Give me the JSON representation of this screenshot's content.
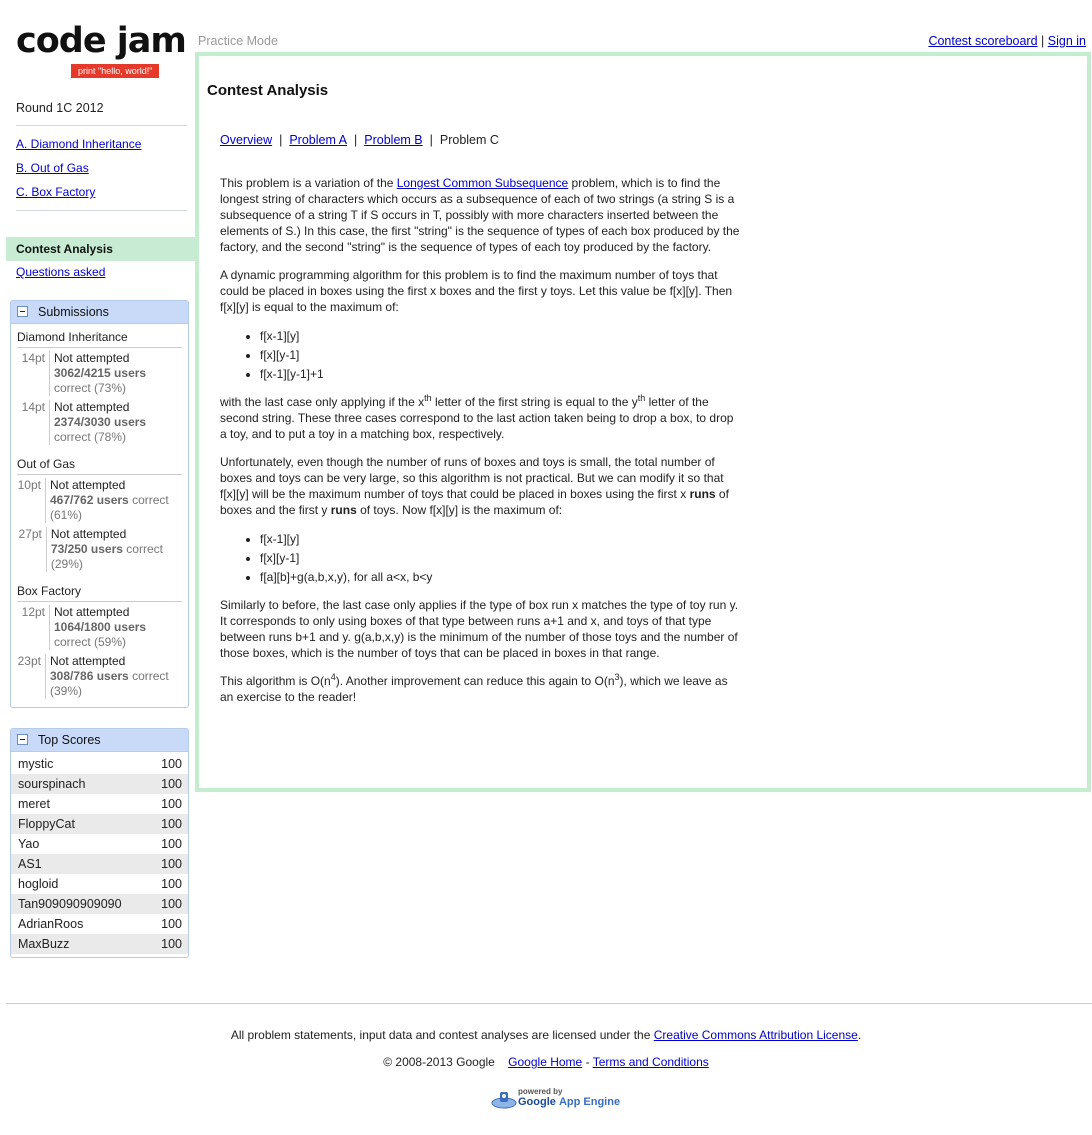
{
  "logo": {
    "text": "code jam",
    "tagline": "print \"hello, world!\""
  },
  "header": {
    "mode": "Practice Mode",
    "scoreboard_link": "Contest scoreboard",
    "separator": "|",
    "signin_link": "Sign in"
  },
  "sidebar": {
    "round": "Round 1C 2012",
    "problems": [
      "A. Diamond Inheritance",
      "B. Out of Gas",
      "C. Box Factory"
    ],
    "active_nav": "Contest Analysis",
    "questions_link": "Questions asked"
  },
  "submissions": {
    "title": "Submissions",
    "groups": [
      {
        "name": "Diamond Inheritance",
        "rows": [
          {
            "pts": "14pt",
            "status": "Not attempted",
            "users": "3062/4215 users",
            "correct": "correct (73%)"
          },
          {
            "pts": "14pt",
            "status": "Not attempted",
            "users": "2374/3030 users",
            "correct": "correct (78%)"
          }
        ]
      },
      {
        "name": "Out of Gas",
        "rows": [
          {
            "pts": "10pt",
            "status": "Not attempted",
            "users": "467/762 users",
            "correct": "correct (61%)"
          },
          {
            "pts": "27pt",
            "status": "Not attempted",
            "users": "73/250 users",
            "correct": "correct (29%)"
          }
        ]
      },
      {
        "name": "Box Factory",
        "rows": [
          {
            "pts": "12pt",
            "status": "Not attempted",
            "users": "1064/1800 users",
            "correct": "correct (59%)"
          },
          {
            "pts": "23pt",
            "status": "Not attempted",
            "users": "308/786 users",
            "correct": "correct (39%)"
          }
        ]
      }
    ]
  },
  "top_scores": {
    "title": "Top Scores",
    "rows": [
      {
        "name": "mystic",
        "score": "100"
      },
      {
        "name": "sourspinach",
        "score": "100"
      },
      {
        "name": "meret",
        "score": "100"
      },
      {
        "name": "FloppyCat",
        "score": "100"
      },
      {
        "name": "Yao",
        "score": "100"
      },
      {
        "name": "AS1",
        "score": "100"
      },
      {
        "name": "hogloid",
        "score": "100"
      },
      {
        "name": "Tan909090909090",
        "score": "100"
      },
      {
        "name": "AdrianRoos",
        "score": "100"
      },
      {
        "name": "MaxBuzz",
        "score": "100"
      }
    ]
  },
  "main": {
    "title": "Contest Analysis",
    "tabs": {
      "overview": "Overview",
      "a": "Problem A",
      "b": "Problem B",
      "c": "Problem C",
      "sep": "|"
    },
    "p1_a": "This problem is a variation of the ",
    "p1_link": "Longest Common Subsequence",
    "p1_b": " problem, which is to find the longest string of characters which occurs as a subsequence of each of two strings (a string S is a subsequence of a string T if S occurs in T, possibly with more characters inserted between the elements of S.) In this case, the first \"string\" is the sequence of types of each box produced by the factory, and the second \"string\" is the sequence of types of each toy produced by the factory.",
    "p2": "A dynamic programming algorithm for this problem is to find the maximum number of toys that could be placed in boxes using the first x boxes and the first y toys. Let this value be f[x][y]. Then f[x][y] is equal to the maximum of:",
    "list1": [
      "f[x-1][y]",
      "f[x][y-1]",
      "f[x-1][y-1]+1"
    ],
    "p3_a": "with the last case only applying if the x",
    "p3_sup1": "th",
    "p3_b": " letter of the first string is equal to the y",
    "p3_sup2": "th",
    "p3_c": " letter of the second string. These three cases correspond to the last action taken being to drop a box, to drop a toy, and to put a toy in a matching box, respectively.",
    "p4_a": "Unfortunately, even though the number of runs of boxes and toys is small, the total number of boxes and toys can be very large, so this algorithm is not practical. But we can modify it so that f[x][y] will be the maximum number of toys that could be placed in boxes using the first x ",
    "p4_runs1": "runs",
    "p4_b": " of boxes and the first y ",
    "p4_runs2": "runs",
    "p4_c": " of toys. Now f[x][y] is the maximum of:",
    "list2": [
      "f[x-1][y]",
      "f[x][y-1]",
      "f[a][b]+g(a,b,x,y), for all a<x, b<y"
    ],
    "p5": "Similarly to before, the last case only applies if the type of box run x matches the type of toy run y. It corresponds to only using boxes of that type between runs a+1 and x, and toys of that type between runs b+1 and y. g(a,b,x,y) is the minimum of the number of those toys and the number of those boxes, which is the number of toys that can be placed in boxes in that range.",
    "p6_a": "This algorithm is O(n",
    "p6_sup1": "4",
    "p6_b": "). Another improvement can reduce this again to O(n",
    "p6_sup2": "3",
    "p6_c": "), which we leave as an exercise to the reader!"
  },
  "footer": {
    "license_text": "All problem statements, input data and contest analyses are licensed under the ",
    "license_link": "Creative Commons Attribution License",
    "license_end": ".",
    "copyright": "© 2008-2013 Google",
    "google_home": "Google Home",
    "dash": "-",
    "terms": "Terms and Conditions",
    "gae_powered": "powered by",
    "gae_google": "Google",
    "gae_appengine": "App Engine"
  }
}
